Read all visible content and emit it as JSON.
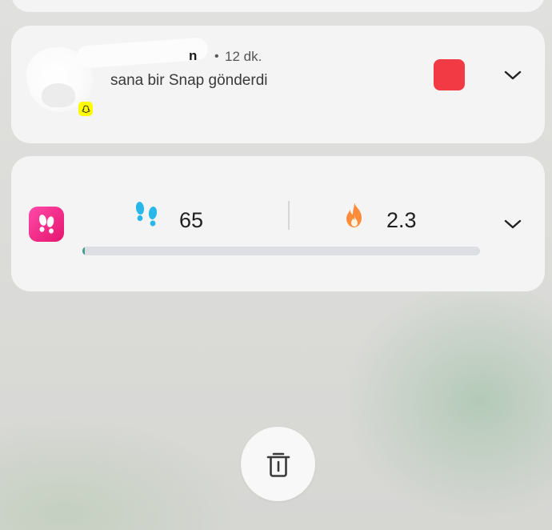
{
  "snap_notification": {
    "sender_visible": "n",
    "separator": "•",
    "time": "12 dk.",
    "message": "sana bir Snap gönderdi",
    "thumbnail_color": "#f23a44",
    "badge_icon": "snapchat-ghost-icon",
    "badge_color": "#fffc00"
  },
  "steps_widget": {
    "app_icon": "pedometer-feet-icon",
    "app_icon_color": "#ec2a86",
    "steps_icon": "footprints-icon",
    "steps_icon_color": "#29b6e8",
    "steps": "65",
    "calories_icon": "flame-icon",
    "calories_icon_color": "#ff8c3a",
    "calories": "2.3",
    "progress_fraction": 0.006
  },
  "actions": {
    "clear_icon": "trash-icon"
  }
}
